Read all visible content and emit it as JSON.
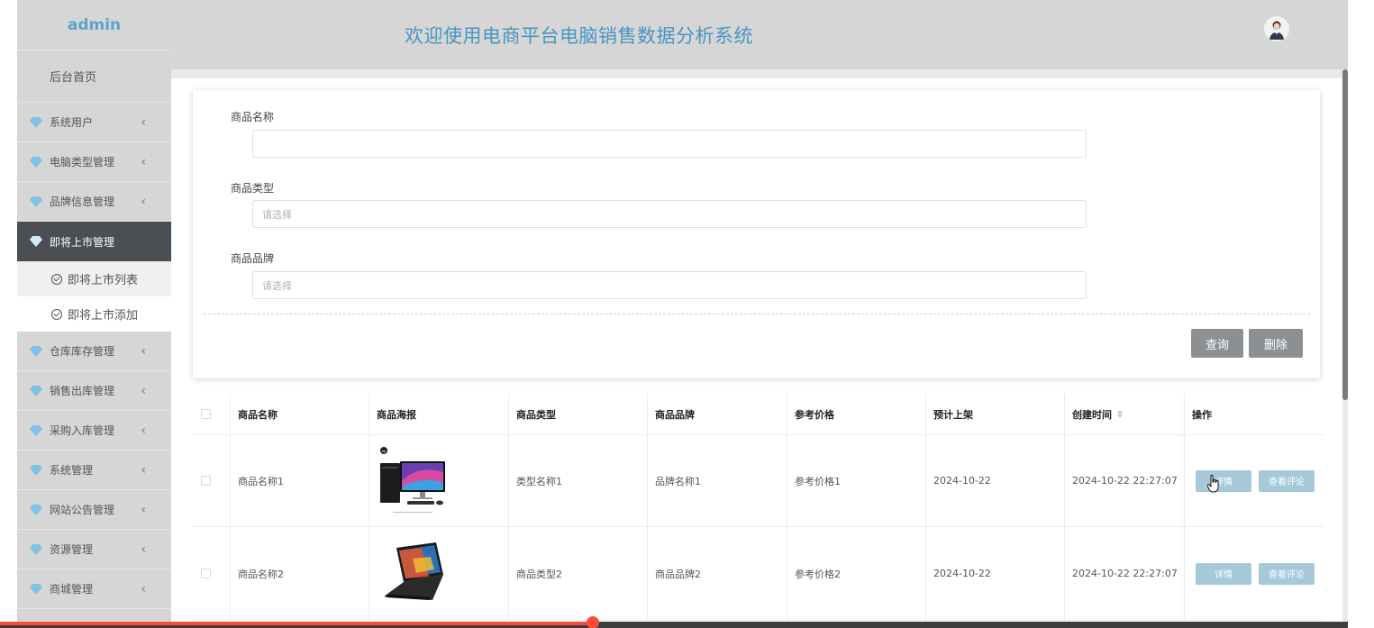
{
  "sidebar": {
    "brand": "admin",
    "home": "后台首页",
    "items": [
      {
        "label": "系统用户"
      },
      {
        "label": "电脑类型管理"
      },
      {
        "label": "品牌信息管理"
      },
      {
        "label": "即将上市管理"
      },
      {
        "label": "仓库库存管理"
      },
      {
        "label": "销售出库管理"
      },
      {
        "label": "采购入库管理"
      },
      {
        "label": "系统管理"
      },
      {
        "label": "网站公告管理"
      },
      {
        "label": "资源管理"
      },
      {
        "label": "商城管理"
      }
    ],
    "sub_items": [
      {
        "label": "即将上市列表"
      },
      {
        "label": "即将上市添加"
      }
    ],
    "accent_color": "#5aa6c9",
    "active_bg": "#4b4e52"
  },
  "header": {
    "title": "欢迎使用电商平台电脑销售数据分析系统",
    "title_color": "#4a95c1"
  },
  "search": {
    "name_label": "商品名称",
    "name_value": "",
    "type_label": "商品类型",
    "type_placeholder": "请选择",
    "brand_label": "商品品牌",
    "brand_placeholder": "请选择",
    "query_button": "查询",
    "delete_button": "删除"
  },
  "table": {
    "columns": [
      "商品名称",
      "商品海报",
      "商品类型",
      "商品品牌",
      "参考价格",
      "预计上架",
      "创建时间",
      "操作"
    ],
    "rows": [
      {
        "name": "商品名称1",
        "poster": "desktop-computer-image",
        "type": "类型名称1",
        "brand": "品牌名称1",
        "price": "参考价格1",
        "release": "2024-10-22",
        "created": "2024-10-22 22:27:07",
        "detail_button": "详情",
        "review_button": "查看评论"
      },
      {
        "name": "商品名称2",
        "poster": "laptop-computer-image",
        "type": "商品类型2",
        "brand": "商品品牌2",
        "price": "参考价格2",
        "release": "2024-10-22",
        "created": "2024-10-22 22:27:07",
        "detail_button": "详情",
        "review_button": "查看评论"
      }
    ]
  },
  "video_progress": {
    "played_fraction": 0.44
  }
}
